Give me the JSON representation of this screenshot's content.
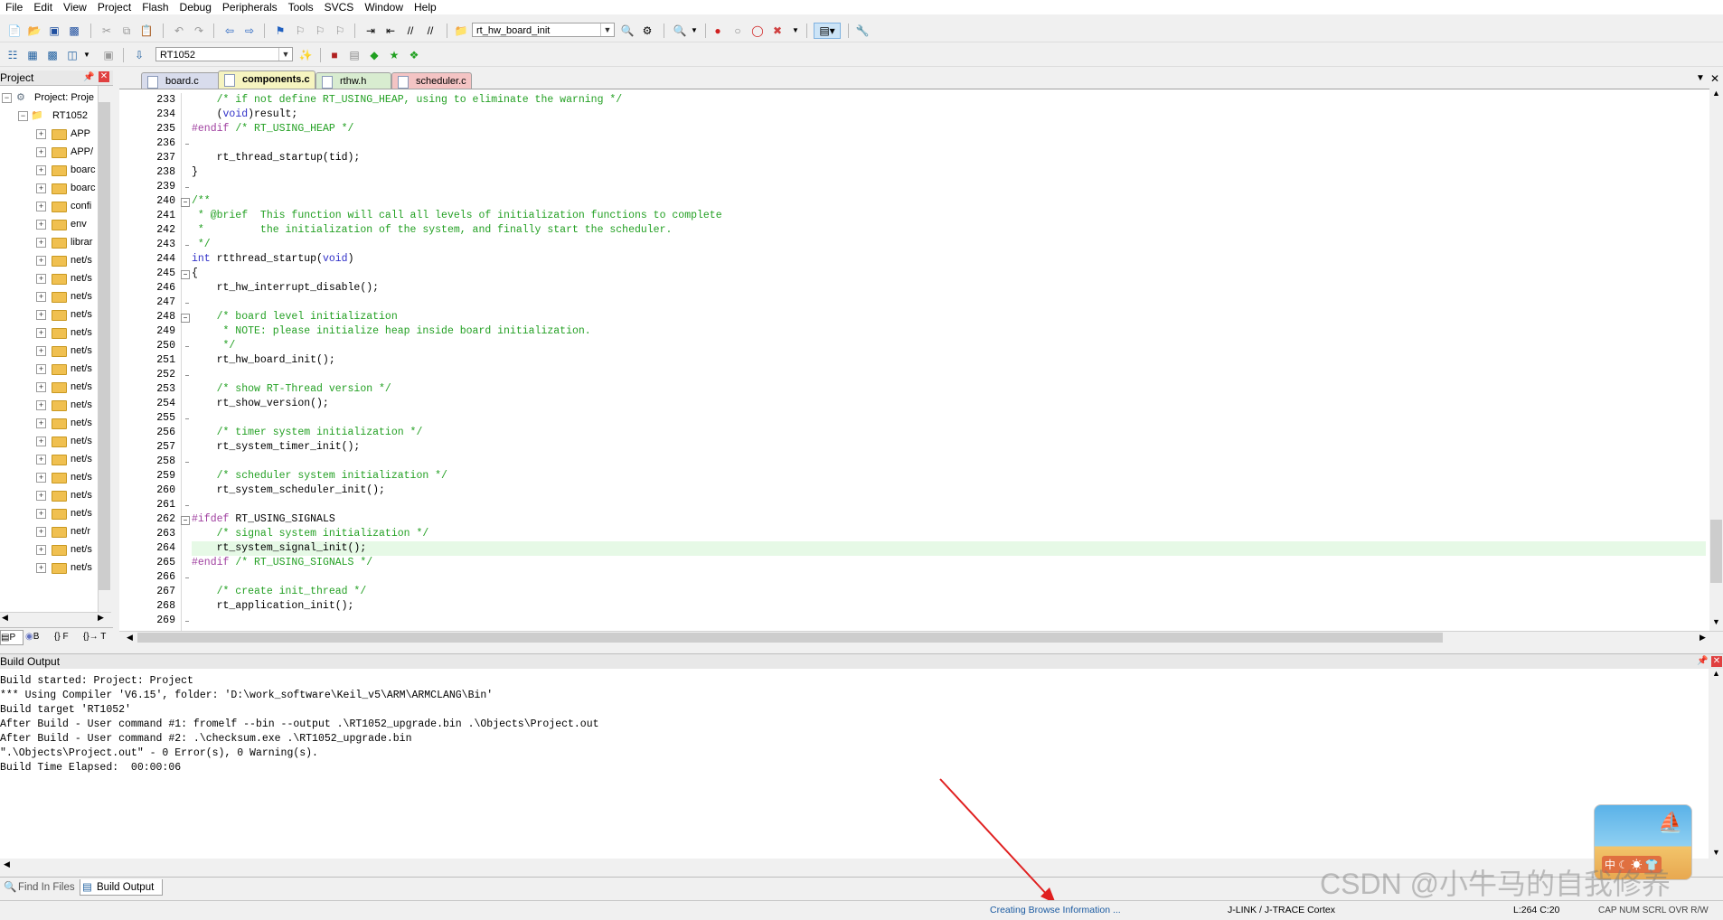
{
  "menu": [
    "File",
    "Edit",
    "View",
    "Project",
    "Flash",
    "Debug",
    "Peripherals",
    "Tools",
    "SVCS",
    "Window",
    "Help"
  ],
  "toolbar": {
    "function_combo": "rt_hw_board_init",
    "target_combo": "RT1052"
  },
  "project_pane": {
    "title": "Project",
    "root": "Project: Proje",
    "target": "RT1052",
    "folders": [
      "APP",
      "APP/",
      "boarc",
      "boarc",
      "confi",
      "env",
      "librar",
      "net/s",
      "net/s",
      "net/s",
      "net/s",
      "net/s",
      "net/s",
      "net/s",
      "net/s",
      "net/s",
      "net/s",
      "net/s",
      "net/s",
      "net/s",
      "net/s",
      "net/s",
      "net/r",
      "net/s",
      "net/s"
    ],
    "tabs": [
      "P",
      "B",
      "{} F",
      "{}→ T"
    ]
  },
  "file_tabs": [
    {
      "label": "board.c",
      "active": false,
      "color": "#d8dcec"
    },
    {
      "label": "components.c",
      "active": true,
      "color": "#f6f4c0"
    },
    {
      "label": "rthw.h",
      "active": false,
      "color": "#d8ecd0"
    },
    {
      "label": "scheduler.c",
      "active": false,
      "color": "#f4c4c4"
    }
  ],
  "code": {
    "highlight_line": 264,
    "lines": [
      {
        "n": 233,
        "t": "    /* if not define RT_USING_HEAP, using to eliminate the warning */",
        "c": "cmt"
      },
      {
        "n": 234,
        "t": "    (void)result;",
        "c": "tx"
      },
      {
        "n": 235,
        "t": "#endif /* RT_USING_HEAP */",
        "c": "cmt"
      },
      {
        "n": 236,
        "t": "",
        "c": "tx"
      },
      {
        "n": 237,
        "t": "    rt_thread_startup(tid);",
        "c": "tx"
      },
      {
        "n": 238,
        "t": "}",
        "c": "tx"
      },
      {
        "n": 239,
        "t": "",
        "c": "tx"
      },
      {
        "n": 240,
        "t": "/**",
        "c": "cmt"
      },
      {
        "n": 241,
        "t": " * @brief  This function will call all levels of initialization functions to complete",
        "c": "cmt"
      },
      {
        "n": 242,
        "t": " *         the initialization of the system, and finally start the scheduler.",
        "c": "cmt"
      },
      {
        "n": 243,
        "t": " */",
        "c": "cmt"
      },
      {
        "n": 244,
        "t": "int rtthread_startup(void)",
        "c": "kw"
      },
      {
        "n": 245,
        "t": "{",
        "c": "tx"
      },
      {
        "n": 246,
        "t": "    rt_hw_interrupt_disable();",
        "c": "tx"
      },
      {
        "n": 247,
        "t": "",
        "c": "tx"
      },
      {
        "n": 248,
        "t": "    /* board level initialization",
        "c": "cmt"
      },
      {
        "n": 249,
        "t": "     * NOTE: please initialize heap inside board initialization.",
        "c": "cmt"
      },
      {
        "n": 250,
        "t": "     */",
        "c": "cmt"
      },
      {
        "n": 251,
        "t": "    rt_hw_board_init();",
        "c": "tx"
      },
      {
        "n": 252,
        "t": "",
        "c": "tx"
      },
      {
        "n": 253,
        "t": "    /* show RT-Thread version */",
        "c": "cmt"
      },
      {
        "n": 254,
        "t": "    rt_show_version();",
        "c": "tx"
      },
      {
        "n": 255,
        "t": "",
        "c": "tx"
      },
      {
        "n": 256,
        "t": "    /* timer system initialization */",
        "c": "cmt"
      },
      {
        "n": 257,
        "t": "    rt_system_timer_init();",
        "c": "tx"
      },
      {
        "n": 258,
        "t": "",
        "c": "tx"
      },
      {
        "n": 259,
        "t": "    /* scheduler system initialization */",
        "c": "cmt"
      },
      {
        "n": 260,
        "t": "    rt_system_scheduler_init();",
        "c": "tx"
      },
      {
        "n": 261,
        "t": "",
        "c": "tx"
      },
      {
        "n": 262,
        "t": "#ifdef RT_USING_SIGNALS",
        "c": "pp"
      },
      {
        "n": 263,
        "t": "    /* signal system initialization */",
        "c": "cmt"
      },
      {
        "n": 264,
        "t": "    rt_system_signal_init();",
        "c": "tx"
      },
      {
        "n": 265,
        "t": "#endif /* RT_USING_SIGNALS */",
        "c": "cmt"
      },
      {
        "n": 266,
        "t": "",
        "c": "tx"
      },
      {
        "n": 267,
        "t": "    /* create init_thread */",
        "c": "cmt"
      },
      {
        "n": 268,
        "t": "    rt_application_init();",
        "c": "tx"
      },
      {
        "n": 269,
        "t": "",
        "c": "tx"
      }
    ]
  },
  "build_output": {
    "title": "Build Output",
    "lines": [
      "Build started: Project: Project",
      "*** Using Compiler 'V6.15', folder: 'D:\\work_software\\Keil_v5\\ARM\\ARMCLANG\\Bin'",
      "Build target 'RT1052'",
      "After Build - User command #1: fromelf --bin --output .\\RT1052_upgrade.bin .\\Objects\\Project.out",
      "After Build - User command #2: .\\checksum.exe .\\RT1052_upgrade.bin",
      "\".\\Objects\\Project.out\" - 0 Error(s), 0 Warning(s).",
      "Build Time Elapsed:  00:00:06"
    ],
    "tabs": [
      "Find In Files",
      "Build Output"
    ]
  },
  "status": {
    "message": "Creating Browse Information ...",
    "debugger": "J-LINK / J-TRACE Cortex",
    "position": "L:264 C:20",
    "flags": "CAP  NUM  SCRL  OVR  R/W"
  },
  "watermark": "CSDN @小牛马的自我修养",
  "colors": {
    "comment": "#23a023",
    "keyword": "#3030c8",
    "highlight": "#e6f9e6",
    "arrow": "#e02020",
    "status_message": "#1a5aa0"
  }
}
